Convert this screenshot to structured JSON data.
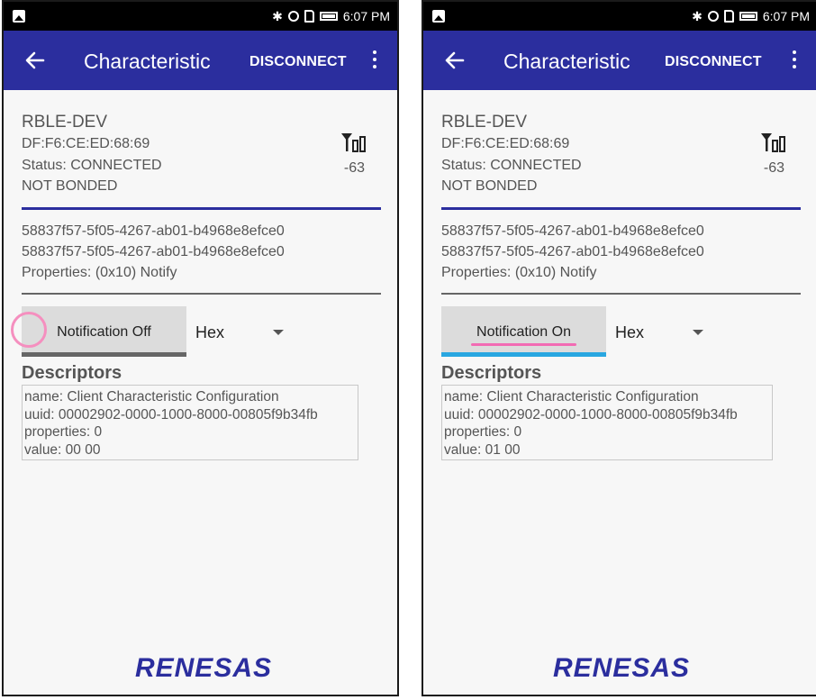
{
  "status_bar": {
    "time": "6:07 PM",
    "icons": [
      "image-icon",
      "bluetooth-icon",
      "gear-icon",
      "sd-card-icon",
      "battery-icon"
    ]
  },
  "app_bar": {
    "title": "Characteristic",
    "disconnect_label": "DISCONNECT",
    "color": "#2b2e9e"
  },
  "device": {
    "name": "RBLE-DEV",
    "address": "DF:F6:CE:ED:68:69",
    "status": "Status:  CONNECTED",
    "bond": "NOT BONDED",
    "rssi": "-63"
  },
  "characteristic": {
    "service_uuid": "58837f57-5f05-4267-ab01-b4968e8efce0",
    "char_uuid": "58837f57-5f05-4267-ab01-b4968e8efce0",
    "properties": "Properties: (0x10) Notify"
  },
  "format_select": {
    "value": "Hex"
  },
  "descriptors_heading": "Descriptors",
  "screens": [
    {
      "notification_label": "Notification Off",
      "descriptor": {
        "name": "name: Client Characteristic Configuration",
        "uuid": "uuid: 00002902-0000-1000-8000-00805f9b34fb",
        "properties": "properties: 0",
        "value": "value: 00 00"
      }
    },
    {
      "notification_label": "Notification On",
      "descriptor": {
        "name": "name: Client Characteristic Configuration",
        "uuid": "uuid: 00002902-0000-1000-8000-00805f9b34fb",
        "properties": "properties: 0",
        "value": "value: 01 00"
      }
    }
  ],
  "logo_text": "RENESAS",
  "colors": {
    "accent_on": "#29a7e1",
    "accent_off": "#666666",
    "highlight": "#f26bb3"
  }
}
